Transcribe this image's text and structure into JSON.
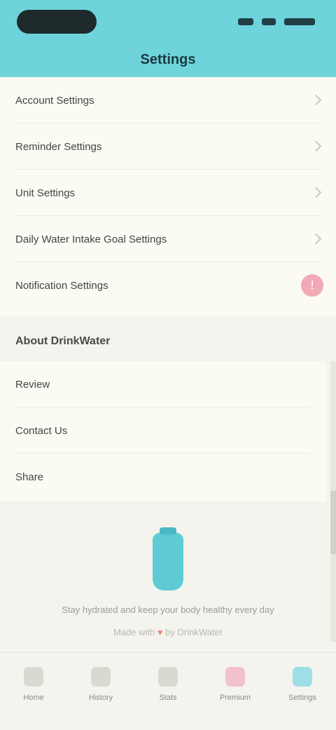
{
  "header": {
    "title": "Settings"
  },
  "settings_rows": [
    {
      "label": "Account Settings"
    },
    {
      "label": "Reminder Settings"
    },
    {
      "label": "Unit Settings"
    },
    {
      "label": "Daily Water Intake Goal Settings"
    },
    {
      "label": "Notification Settings"
    }
  ],
  "about_section": {
    "title": "About DrinkWater",
    "items": [
      {
        "label": "Review"
      },
      {
        "label": "Contact Us"
      },
      {
        "label": "Share"
      }
    ]
  },
  "footer": {
    "message": "Stay hydrated and keep your body healthy every day",
    "link_prefix": "Made with",
    "link_accent": "♥",
    "link_suffix": "by DrinkWater"
  },
  "tabbar": {
    "tabs": [
      {
        "label": "Home",
        "icon": "home-icon",
        "color": "#d9d8d1"
      },
      {
        "label": "History",
        "icon": "calendar-icon",
        "color": "#d9d8d1"
      },
      {
        "label": "Stats",
        "icon": "chart-icon",
        "color": "#d9d8d1"
      },
      {
        "label": "Premium",
        "icon": "crown-icon",
        "color": "#f3c1cb"
      },
      {
        "label": "Settings",
        "icon": "gear-icon",
        "color": "#9edfe6"
      }
    ]
  }
}
